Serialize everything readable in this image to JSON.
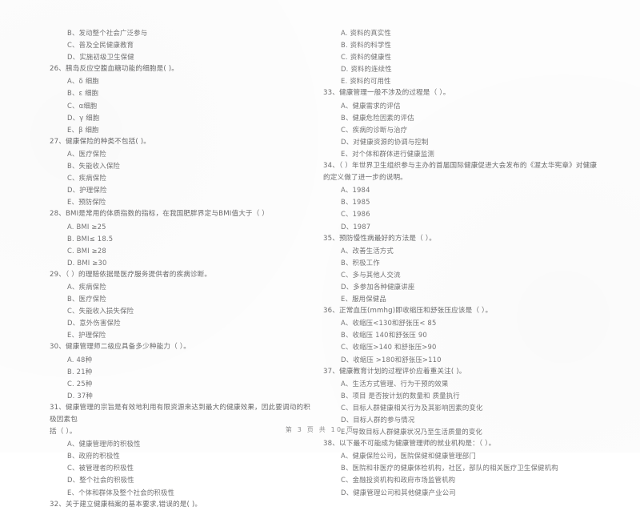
{
  "document": {
    "type": "scanned-exam-paper",
    "footer": "第 3 页  共 10 页",
    "page_number": "3",
    "total_pages": "10"
  },
  "left_column": {
    "items": [
      {
        "kind": "option",
        "text": "B、发动整个社会广泛参与"
      },
      {
        "kind": "option",
        "text": "C、普及全民健康教育"
      },
      {
        "kind": "option",
        "text": "D、实施初级卫生保健"
      },
      {
        "kind": "question",
        "number": "26",
        "text": "26、胰岛反应空腹血糖功能的细胞是(        )。"
      },
      {
        "kind": "option",
        "text": "A、δ 细胞"
      },
      {
        "kind": "option",
        "text": "B、ε 细胞"
      },
      {
        "kind": "option",
        "text": "C、α细胞"
      },
      {
        "kind": "option",
        "text": "D、γ 细胞"
      },
      {
        "kind": "option",
        "text": "E、β 细胞"
      },
      {
        "kind": "question",
        "number": "27",
        "text": "27、健康保险的种类不包括(        )。"
      },
      {
        "kind": "option",
        "text": "A、医疗保险"
      },
      {
        "kind": "option",
        "text": "B、失能收入保险"
      },
      {
        "kind": "option",
        "text": "C、疾病保险"
      },
      {
        "kind": "option",
        "text": "D、护理保险"
      },
      {
        "kind": "option",
        "text": "E、预防保险"
      },
      {
        "kind": "question",
        "number": "28",
        "text": "28、BMI是常用的体质指数的指标，在我国肥胖界定与BMI值大于（        ）"
      },
      {
        "kind": "option",
        "text": "A. BMI ≥25"
      },
      {
        "kind": "option",
        "text": "B. BMI≤ 18.5"
      },
      {
        "kind": "option",
        "text": "C. BMI ≥28"
      },
      {
        "kind": "option",
        "text": "D. BMI ≥30"
      },
      {
        "kind": "question",
        "number": "29",
        "text": "29、（        ）的理赔依据是医疗服务提供者的疾病诊断。"
      },
      {
        "kind": "option",
        "text": "A、疾病保险"
      },
      {
        "kind": "option",
        "text": "B、医疗保险"
      },
      {
        "kind": "option",
        "text": "C、失能收入损失保险"
      },
      {
        "kind": "option",
        "text": "D、意外伤害保险"
      },
      {
        "kind": "option",
        "text": "E、护理保险"
      },
      {
        "kind": "question",
        "number": "30",
        "text": "30、健康管理师二级应具备多少种能力（        ）。"
      },
      {
        "kind": "option",
        "text": "A. 48种"
      },
      {
        "kind": "option",
        "text": "B. 21种"
      },
      {
        "kind": "option",
        "text": "C. 25种"
      },
      {
        "kind": "option",
        "text": "D. 37种"
      },
      {
        "kind": "question-wrap",
        "number": "31",
        "text": "31、健康管理的宗旨是有效地利用有限资源来达到最大的健康效果，因此要调动的积极因素包",
        "text_line2": "括（        ）。"
      },
      {
        "kind": "option",
        "text": "A、健康管理师的积极性"
      },
      {
        "kind": "option",
        "text": "B、政府的积极性"
      },
      {
        "kind": "option",
        "text": "C、被管理者的积极性"
      },
      {
        "kind": "option",
        "text": "D、整个社会的积极性"
      },
      {
        "kind": "option",
        "text": "E、个体和群体及整个社会的积极性"
      },
      {
        "kind": "question",
        "number": "32",
        "text": "32、关于建立健康档案的基本要求,错误的是(        )。"
      }
    ]
  },
  "right_column": {
    "items": [
      {
        "kind": "option",
        "text": "A. 资料的真实性"
      },
      {
        "kind": "option",
        "text": "B. 资料的科学性"
      },
      {
        "kind": "option",
        "text": "C. 资料的健康性"
      },
      {
        "kind": "option",
        "text": "D. 资料的连续性"
      },
      {
        "kind": "option",
        "text": "E. 资料的可用性"
      },
      {
        "kind": "question",
        "number": "33",
        "text": "33、健康管理一般不涉及的过程是（        ）。"
      },
      {
        "kind": "option",
        "text": "A、健康需求的评估"
      },
      {
        "kind": "option",
        "text": "B、健康危险因素的评估"
      },
      {
        "kind": "option",
        "text": "C、疾病的诊断与治疗"
      },
      {
        "kind": "option",
        "text": "D、对健康资源的协调与控制"
      },
      {
        "kind": "option",
        "text": "E、对个体和群体进行健康监测"
      },
      {
        "kind": "question-wrap",
        "number": "34",
        "text": "34、（        ）年世界卫生组织参与主办的首届国际健康促进大会发布的《渥太华宪章》对健康",
        "text_line2": "的定义做了进一步的说明。"
      },
      {
        "kind": "option",
        "text": "A、1984"
      },
      {
        "kind": "option",
        "text": "B、1985"
      },
      {
        "kind": "option",
        "text": "C、1986"
      },
      {
        "kind": "option",
        "text": "D、1987"
      },
      {
        "kind": "question",
        "number": "35",
        "text": "35、预防慢性病最好的方法是（        ）。"
      },
      {
        "kind": "option",
        "text": "A、改善生活方式"
      },
      {
        "kind": "option",
        "text": "B、积极工作"
      },
      {
        "kind": "option",
        "text": "C、多与其他人交流"
      },
      {
        "kind": "option",
        "text": "D、多参加各种健康讲座"
      },
      {
        "kind": "option",
        "text": "E、服用保健品"
      },
      {
        "kind": "question",
        "number": "36",
        "text": "36、正常血压(mmhg)即收缩压和舒张压应该是（        ）。"
      },
      {
        "kind": "option",
        "text": "A、收缩压<130和舒张压< 85"
      },
      {
        "kind": "option",
        "text": "B、收缩压 140和舒张压 90"
      },
      {
        "kind": "option",
        "text": "C、收缩压>140 和舒张压>90"
      },
      {
        "kind": "option",
        "text": "D、收缩压 >180和舒张压>110"
      },
      {
        "kind": "question",
        "number": "37",
        "text": "37、健康教育计划的过程评价应着重关注(        )。"
      },
      {
        "kind": "option",
        "text": "A、生活方式管理、行为干预的效果"
      },
      {
        "kind": "option",
        "text": "B、项目 是否按计划的数量和 质量执行"
      },
      {
        "kind": "option",
        "text": "C、目标人群健康相关行为及其影响因素的变化"
      },
      {
        "kind": "option",
        "text": "D、目标人群的参与情况"
      },
      {
        "kind": "option",
        "text": "E、导致目标人群健康状况乃至生活质量的变化"
      },
      {
        "kind": "question",
        "number": "38",
        "text": "38、以下最不可能成为健康管理师的就业机构是：（        ）。"
      },
      {
        "kind": "option",
        "text": "A、健康保险公司，医院保健和健康管理部门"
      },
      {
        "kind": "option",
        "text": "B、医院和非医疗的健康体检机构，社区，部队的相关医疗卫生保健机构"
      },
      {
        "kind": "option",
        "text": "C、金融投资机构和政府市场监管机构"
      },
      {
        "kind": "option",
        "text": "D、健康管理公司和其他健康产业公司"
      }
    ]
  }
}
